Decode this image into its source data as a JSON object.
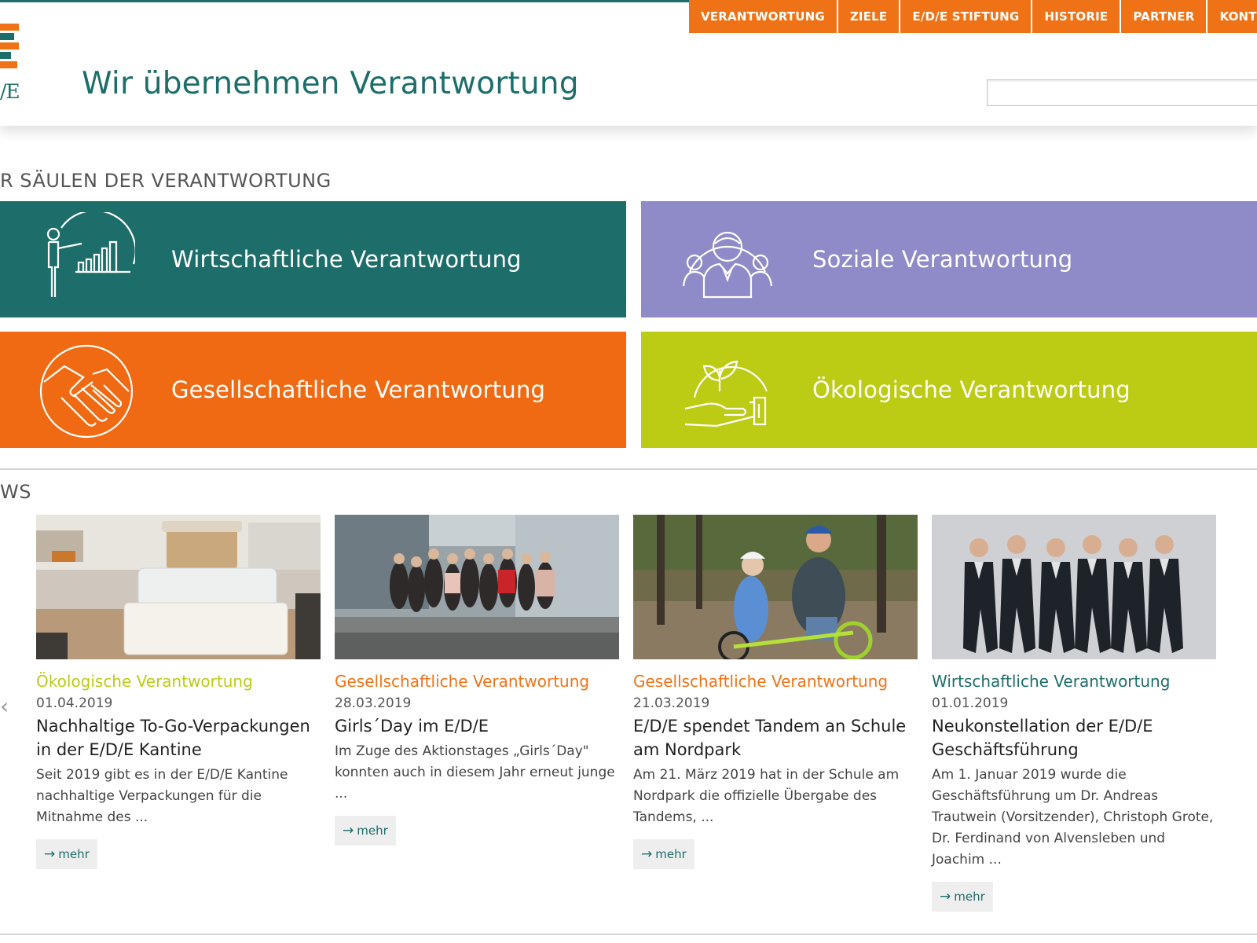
{
  "logo": {
    "text": "/E"
  },
  "header": {
    "title": "Wir übernehmen Verantwortung"
  },
  "nav": {
    "items": [
      {
        "label": "VERANTWORTUNG"
      },
      {
        "label": "ZIELE"
      },
      {
        "label": "E/D/E STIFTUNG"
      },
      {
        "label": "HISTORIE"
      },
      {
        "label": "PARTNER"
      },
      {
        "label": "KONT"
      }
    ]
  },
  "search": {
    "value": ""
  },
  "pillars": {
    "heading": "R SÄULEN DER VERANTWORTUNG",
    "tiles": [
      {
        "label": "Wirtschaftliche Verantwortung",
        "icon": "presentation-chart-icon",
        "color": "#1d6e6a"
      },
      {
        "label": "Soziale Verantwortung",
        "icon": "people-group-icon",
        "color": "#8f8bc8"
      },
      {
        "label": "Gesellschaftliche Verantwortung",
        "icon": "handshake-icon",
        "color": "#ef6a12"
      },
      {
        "label": "Ökologische Verantwortung",
        "icon": "plant-in-hand-icon",
        "color": "#bccb14"
      }
    ]
  },
  "news": {
    "heading": "WS",
    "more_label": "mehr",
    "items": [
      {
        "category": "Ökologische Verantwortung",
        "category_color": "#bccb14",
        "date": "01.04.2019",
        "title": "Nachhaltige To-Go-Verpackungen in der E/D/E Kantine",
        "teaser": "Seit 2019 gibt es in der E/D/E Kantine nachhaltige Verpackungen für die Mitnahme des ...",
        "image": "food-container-photo"
      },
      {
        "category": "Gesellschaftliche Verantwortung",
        "category_color": "#ef7316",
        "date": "28.03.2019",
        "title": "Girls´Day im E/D/E",
        "teaser": "Im Zuge des Aktionstages „Girls´Day\" konnten auch in diesem Jahr erneut junge ...",
        "image": "group-photo"
      },
      {
        "category": "Gesellschaftliche Verantwortung",
        "category_color": "#ef7316",
        "date": "21.03.2019",
        "title": "E/D/E spendet Tandem an Schule am Nordpark",
        "teaser": "Am 21. März 2019 hat in der Schule am Nordpark die offizielle Übergabe des Tandems, ...",
        "image": "tandem-photo"
      },
      {
        "category": "Wirtschaftliche Verantwortung",
        "category_color": "#1d6e6a",
        "date": "01.01.2019",
        "title": "Neukonstellation der E/D/E Geschäftsführung",
        "teaser": "Am 1. Januar 2019 wurde die Geschäftsführung um Dr. Andreas Trautwein (Vorsitzender), Christoph Grote, Dr. Ferdinand von Alvensleben und Joachim ...",
        "image": "management-photo"
      }
    ]
  }
}
